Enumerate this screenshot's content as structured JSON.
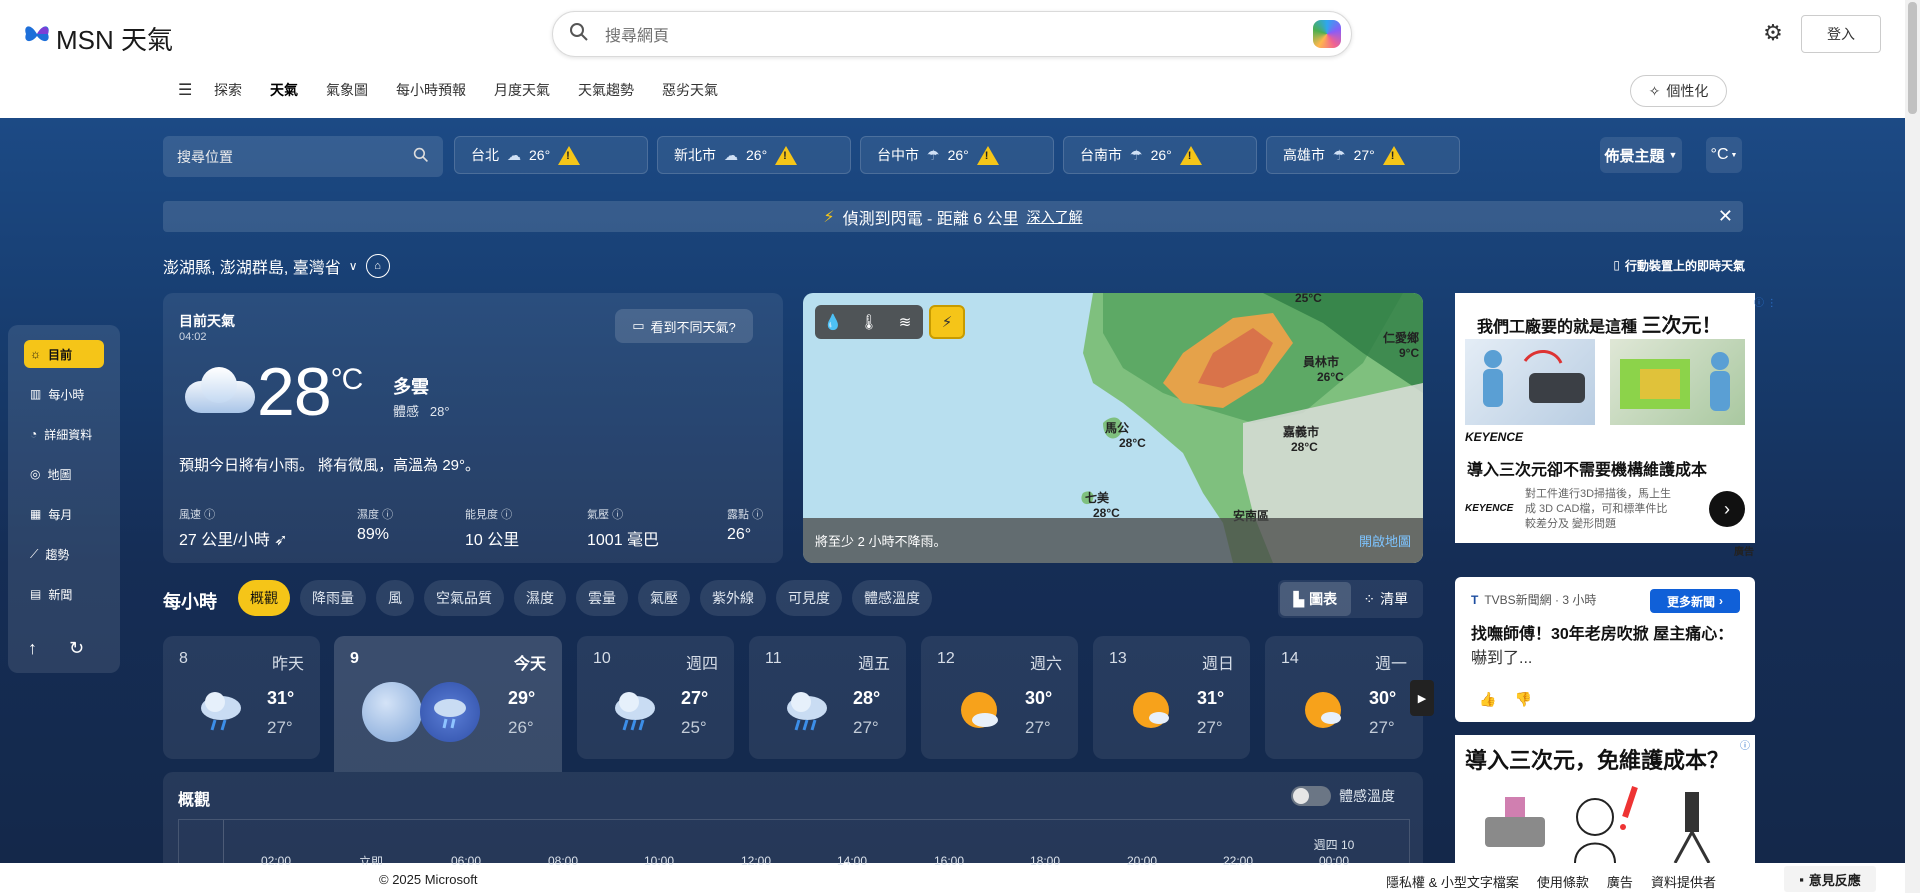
{
  "header": {
    "logo_text": "MSN 天氣",
    "search_placeholder": "搜尋網頁",
    "signin_label": "登入",
    "personalize_label": "個性化",
    "nav": [
      {
        "label": "探索"
      },
      {
        "label": "天氣",
        "active": true
      },
      {
        "label": "氣象圖"
      },
      {
        "label": "每小時預報"
      },
      {
        "label": "月度天氣"
      },
      {
        "label": "天氣趨勢"
      },
      {
        "label": "惡劣天氣"
      }
    ]
  },
  "toolbar": {
    "location_placeholder": "搜尋位置",
    "cities": [
      {
        "name": "台北",
        "temp": "26°"
      },
      {
        "name": "新北市",
        "temp": "26°"
      },
      {
        "name": "台中市",
        "temp": "26°"
      },
      {
        "name": "台南市",
        "temp": "26°"
      },
      {
        "name": "高雄市",
        "temp": "27°"
      }
    ],
    "theme_label": "佈景主題",
    "unit_label": "°C"
  },
  "alert": {
    "text": "偵測到閃電 - 距離 6 公里",
    "link": "深入了解"
  },
  "location": {
    "name": "澎湖縣, 澎湖群島, 臺灣省",
    "mobile_label": "行動裝置上的即時天氣"
  },
  "rail": {
    "items": [
      {
        "label": "目前",
        "icon": "sun-icon",
        "selected": true
      },
      {
        "label": "每小時",
        "icon": "hourly-icon"
      },
      {
        "label": "詳細資料",
        "icon": "details-icon"
      },
      {
        "label": "地圖",
        "icon": "map-pin-icon"
      },
      {
        "label": "每月",
        "icon": "calendar-icon"
      },
      {
        "label": "趨勢",
        "icon": "trend-icon"
      },
      {
        "label": "新聞",
        "icon": "news-icon"
      }
    ]
  },
  "current": {
    "heading": "目前天氣",
    "time": "04:02",
    "see_different": "看到不同天氣?",
    "temp": "28",
    "unit": "°C",
    "condition": "多雲",
    "feels_label": "體感",
    "feels_value": "28°",
    "summary": "預期今日將有小雨。 將有微風，高溫為 29°。",
    "stats": [
      {
        "label": "風速",
        "value": "27 公里/小時"
      },
      {
        "label": "濕度",
        "value": "89%"
      },
      {
        "label": "能見度",
        "value": "10 公里"
      },
      {
        "label": "氣壓",
        "value": "1001 毫巴"
      },
      {
        "label": "露點",
        "value": "26°"
      }
    ]
  },
  "map": {
    "caption": "將至少 2 小時不降雨。",
    "open_label": "開啟地圖",
    "cities": [
      {
        "name": "馬公",
        "temp": "28°C"
      },
      {
        "name": "七美",
        "temp": "28°C"
      },
      {
        "name": "嘉義市",
        "temp": "28°C"
      },
      {
        "name": "員林市",
        "temp": "26°C"
      },
      {
        "name": "仁愛鄉",
        "temp": "9°C"
      },
      {
        "name": "安南區",
        "temp": ""
      },
      {
        "name": "",
        "temp": "25°C"
      }
    ]
  },
  "hourly": {
    "title": "每小時",
    "chips": [
      "概觀",
      "降雨量",
      "風",
      "空氣品質",
      "濕度",
      "雲量",
      "氣壓",
      "紫外線",
      "可見度",
      "體感溫度"
    ],
    "view_chart": "圖表",
    "view_list": "清單"
  },
  "days": [
    {
      "date": "8",
      "weekday": "昨天",
      "hi": "31°",
      "lo": "27°",
      "icon": "rain-icon"
    },
    {
      "date": "9",
      "weekday": "今天",
      "hi": "29°",
      "lo": "26°",
      "icon": "rain-icon"
    },
    {
      "date": "10",
      "weekday": "週四",
      "hi": "27°",
      "lo": "25°",
      "icon": "rain-icon"
    },
    {
      "date": "11",
      "weekday": "週五",
      "hi": "28°",
      "lo": "27°",
      "icon": "rain-icon"
    },
    {
      "date": "12",
      "weekday": "週六",
      "hi": "30°",
      "lo": "27°",
      "icon": "partly-sunny-icon"
    },
    {
      "date": "13",
      "weekday": "週日",
      "hi": "31°",
      "lo": "27°",
      "icon": "partly-sunny-icon"
    },
    {
      "date": "14",
      "weekday": "週一",
      "hi": "30°",
      "lo": "27°",
      "icon": "partly-sunny-icon"
    }
  ],
  "overview": {
    "title": "概觀",
    "feels_toggle": "體感溫度",
    "ticks": [
      "02:00",
      "立即",
      "06:00",
      "08:00",
      "10:00",
      "12:00",
      "14:00",
      "16:00",
      "18:00",
      "20:00",
      "22:00",
      "00:00"
    ],
    "next_day": "週四 10"
  },
  "ad1": {
    "title": "我們工廠要的就是這種",
    "title_bold": "三次元！",
    "brand": "KEYENCE",
    "headline": "導入三次元卻不需要機構維護成本",
    "sub": "對工件進行3D掃描後，馬上生成 3D CAD檔，可和標準件比較差分及 變形問題",
    "ad_label": "廣告"
  },
  "news": {
    "source": "TVBS新聞網 · 3 小時",
    "more": "更多新聞",
    "headline": "找嘸師傅！30年老房吹掀 屋主痛心：",
    "headline_tail": "嚇到了..."
  },
  "ad2": {
    "title": "導入三次元，免維護成本？"
  },
  "footer": {
    "copyright": "© 2025 Microsoft",
    "links": [
      "隱私權 & 小型文字檔案",
      "使用條款",
      "廣告",
      "資料提供者"
    ],
    "feedback": "意見反應"
  },
  "colors": {
    "accent": "#f5c518",
    "panel_top": "#1c4a85",
    "panel_bottom": "#14284a",
    "link_blue": "#1060d8"
  }
}
